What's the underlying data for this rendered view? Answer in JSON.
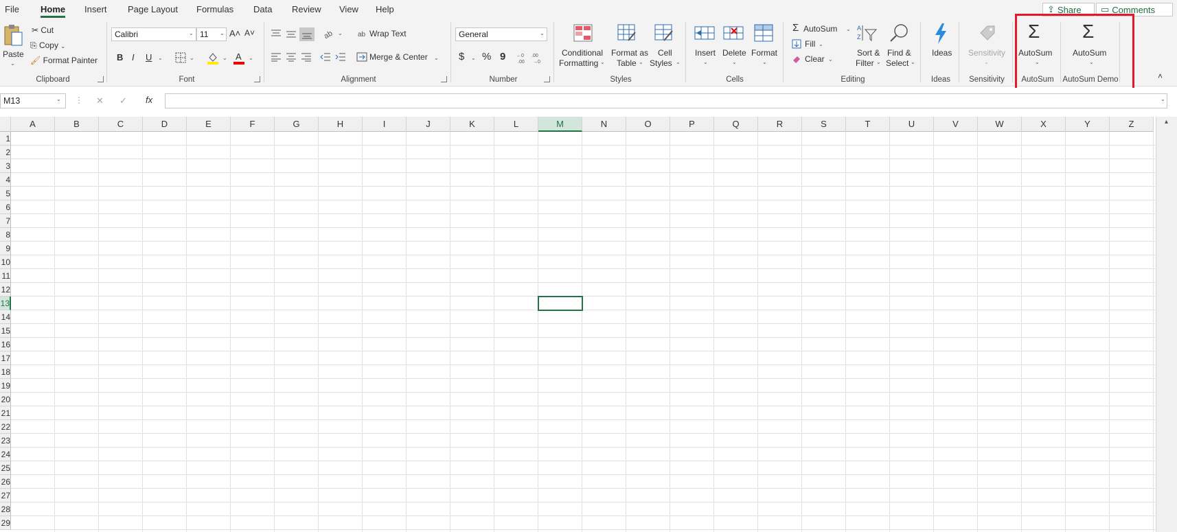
{
  "tabs": [
    "File",
    "Home",
    "Insert",
    "Page Layout",
    "Formulas",
    "Data",
    "Review",
    "View",
    "Help"
  ],
  "active_tab": "Home",
  "top_buttons": {
    "share": "Share",
    "comments": "Comments"
  },
  "ribbon": {
    "clipboard": {
      "label": "Clipboard",
      "paste": "Paste",
      "cut": "Cut",
      "copy": "Copy",
      "format_painter": "Format Painter"
    },
    "font": {
      "label": "Font",
      "font_name": "Calibri",
      "font_size": "11",
      "bold": "B",
      "italic": "I",
      "underline": "U"
    },
    "alignment": {
      "label": "Alignment",
      "wrap_text": "Wrap Text",
      "merge_center": "Merge & Center"
    },
    "number": {
      "label": "Number",
      "format": "General",
      "currency": "$",
      "percent": "%",
      "comma": "9"
    },
    "styles": {
      "label": "Styles",
      "conditional_l1": "Conditional",
      "conditional_l2": "Formatting",
      "format_table_l1": "Format as",
      "format_table_l2": "Table",
      "cell_styles_l1": "Cell",
      "cell_styles_l2": "Styles"
    },
    "cells": {
      "label": "Cells",
      "insert": "Insert",
      "delete": "Delete",
      "format": "Format"
    },
    "editing": {
      "label": "Editing",
      "autosum": "AutoSum",
      "fill": "Fill",
      "clear": "Clear",
      "sort_l1": "Sort &",
      "sort_l2": "Filter",
      "find_l1": "Find &",
      "find_l2": "Select"
    },
    "ideas": {
      "label": "Ideas",
      "button": "Ideas"
    },
    "sensitivity": {
      "label": "Sensitivity",
      "button": "Sensitivity"
    },
    "autosum_group": {
      "label": "AutoSum",
      "button": "AutoSum"
    },
    "autosum_demo_group": {
      "label": "AutoSum Demo",
      "button": "AutoSum"
    }
  },
  "formula_bar": {
    "name_box": "M13",
    "cancel": "✕",
    "enter": "✓",
    "fx": "fx",
    "value": ""
  },
  "columns": [
    "A",
    "B",
    "C",
    "D",
    "E",
    "F",
    "G",
    "H",
    "I",
    "J",
    "K",
    "L",
    "M",
    "N",
    "O",
    "P",
    "Q",
    "R",
    "S",
    "T",
    "U",
    "V",
    "W",
    "X",
    "Y",
    "Z"
  ],
  "rows": [
    "1",
    "2",
    "3",
    "4",
    "5",
    "6",
    "7",
    "8",
    "9",
    "10",
    "11",
    "12",
    "13",
    "14",
    "15",
    "16",
    "17",
    "18",
    "19",
    "20",
    "21",
    "22",
    "23",
    "24",
    "25",
    "26",
    "27",
    "28",
    "29"
  ],
  "selected_cell": {
    "column": "M",
    "row": "13"
  },
  "colors": {
    "accent": "#217346",
    "highlight_box": "#e3182d"
  }
}
